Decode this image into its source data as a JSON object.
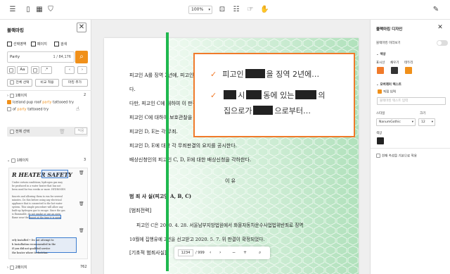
{
  "toolbar": {
    "zoom": "100%",
    "icons": [
      "menu-icon",
      "sidebar-toggle-icon",
      "thumbnail-view-icon",
      "bookmark-icon",
      "page-fit-icon",
      "scroll-mode-icon",
      "pointer-icon",
      "hand-icon",
      "edit-icon"
    ]
  },
  "left_panel": {
    "title": "블랙마킹",
    "tabs": [
      "선택영역",
      "페이지",
      "검색"
    ],
    "search_value": "Party",
    "search_count": "1 / 84,176",
    "options": [
      "Aa",
      ".*"
    ],
    "buttons": [
      "전체 선택",
      "비교 적용",
      "마킹 추가"
    ],
    "group1": {
      "label": "1페이지",
      "count": "2"
    },
    "results": [
      {
        "pre": "Iceland pup roof ",
        "hit": "party",
        "post": " tattooed try"
      },
      {
        "pre": "of ",
        "hit": "party",
        "post": " tattooed try"
      }
    ],
    "select_all": "전체 선택",
    "apply": "적용",
    "group2": {
      "label": "1페이지",
      "count": "3"
    },
    "thumb_heading": "R HEATER SAFETY",
    "thumb_lines": [
      "Under certain conditions, hydrogen gas may",
      "be produced in a water heater that has not",
      "been used for two weeks or more. HYDROGEN",
      "",
      "faucets and allowing them to run for several",
      "minutes. Do this before using any electrical",
      "appliance that is connected to the hot water",
      "system. This simple procedure will allow any",
      "built-up hydrogen gas to escape. Since the gas",
      "is flammable, do not smoke or use an open",
      "flame near the faucet at the time it is open."
    ],
    "thumb_lines2": [
      "erly installed   • Do not attempt to",
      "h Installation     recommended in the",
      "If you did not    qualified service",
      "the heater where  technician."
    ],
    "group3": {
      "label": "2페이지",
      "count": "762"
    }
  },
  "document": {
    "lines": [
      "피고인 A를 징역 2년에, 피고인 B를",
      "다.",
      "다만, 피고인 C에 대하여 이 판결",
      "피고인 C에 대하여 보호관찰을 받을",
      "피고인 D, E는 각 무죄.",
      "피고인 D, E에 대한 각 무죄판결의 요지를 공시한다.",
      "배상신청인의 피고인 C, D, E에 대한 배상신청을 각하한다."
    ],
    "section_title": "이   유",
    "crime_heading": "범 죄 사 실(피고인 A, B, C)",
    "sub_heading": "[범죄전력]",
    "para1": "피고인 C은 2020. 4. 28. 서울남부지방법원에서 화물자동차운수사업법위반죄로 징역",
    "para2": "10월에 집행유예 2년을 선고받고 2020. 5. 7. 위 판결이 확정되었다.",
    "sub_heading2": "[기초적 범죄사실]"
  },
  "page_nav": {
    "current": "1234",
    "total": "/ 999"
  },
  "popup": {
    "line1_pre": "피고인",
    "line1_post": "을 징역 2년에…",
    "line2_a": "시",
    "line2_b": "동에 있는",
    "line2_c": "의",
    "line3_pre": "집으로가",
    "line3_post": "으로부터…"
  },
  "right_panel": {
    "title": "블랙마킹 디자인",
    "preview_label": "블랙마킹 미리보기",
    "color_section": "색상",
    "color_labels": [
      "표시선",
      "채우기",
      "테두리"
    ],
    "colors": {
      "accent": "#f07a2a",
      "fill": "#333333",
      "border": "#f0901a"
    },
    "overlay_section": "오버레이 텍스트",
    "overlay_check": "직접 입력",
    "overlay_placeholder": "블랙마킹 텍스트 입력",
    "style_label": "스타일",
    "size_label": "크기",
    "font_value": "NanumGothic",
    "size_value": "12",
    "color_label": "색상",
    "footer_check": "현재 속성을 기본으로 적용"
  }
}
